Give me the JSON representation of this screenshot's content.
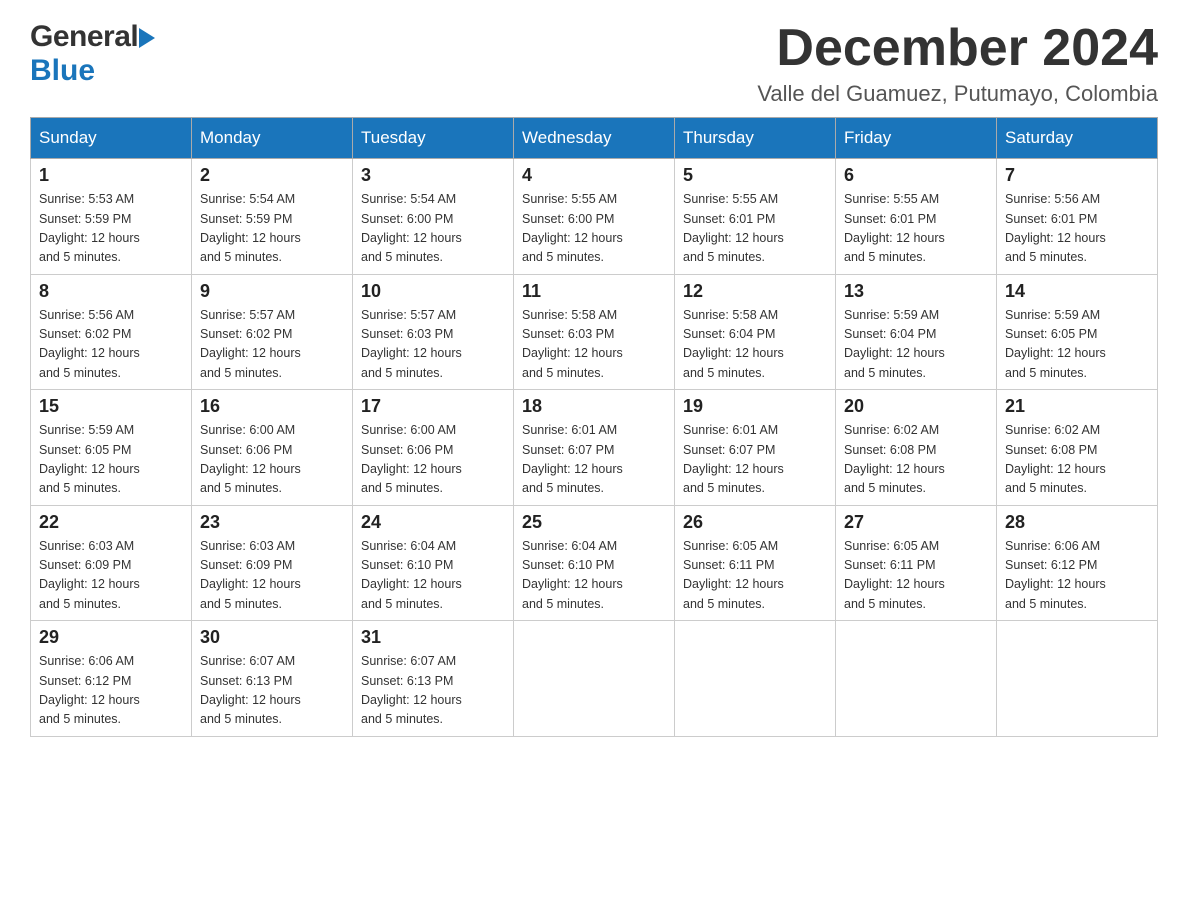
{
  "header": {
    "logo_general": "General",
    "logo_blue": "Blue",
    "month_title": "December 2024",
    "location": "Valle del Guamuez, Putumayo, Colombia"
  },
  "weekdays": [
    "Sunday",
    "Monday",
    "Tuesday",
    "Wednesday",
    "Thursday",
    "Friday",
    "Saturday"
  ],
  "weeks": [
    [
      {
        "day": "1",
        "sunrise": "5:53 AM",
        "sunset": "5:59 PM",
        "daylight": "12 hours and 5 minutes."
      },
      {
        "day": "2",
        "sunrise": "5:54 AM",
        "sunset": "5:59 PM",
        "daylight": "12 hours and 5 minutes."
      },
      {
        "day": "3",
        "sunrise": "5:54 AM",
        "sunset": "6:00 PM",
        "daylight": "12 hours and 5 minutes."
      },
      {
        "day": "4",
        "sunrise": "5:55 AM",
        "sunset": "6:00 PM",
        "daylight": "12 hours and 5 minutes."
      },
      {
        "day": "5",
        "sunrise": "5:55 AM",
        "sunset": "6:01 PM",
        "daylight": "12 hours and 5 minutes."
      },
      {
        "day": "6",
        "sunrise": "5:55 AM",
        "sunset": "6:01 PM",
        "daylight": "12 hours and 5 minutes."
      },
      {
        "day": "7",
        "sunrise": "5:56 AM",
        "sunset": "6:01 PM",
        "daylight": "12 hours and 5 minutes."
      }
    ],
    [
      {
        "day": "8",
        "sunrise": "5:56 AM",
        "sunset": "6:02 PM",
        "daylight": "12 hours and 5 minutes."
      },
      {
        "day": "9",
        "sunrise": "5:57 AM",
        "sunset": "6:02 PM",
        "daylight": "12 hours and 5 minutes."
      },
      {
        "day": "10",
        "sunrise": "5:57 AM",
        "sunset": "6:03 PM",
        "daylight": "12 hours and 5 minutes."
      },
      {
        "day": "11",
        "sunrise": "5:58 AM",
        "sunset": "6:03 PM",
        "daylight": "12 hours and 5 minutes."
      },
      {
        "day": "12",
        "sunrise": "5:58 AM",
        "sunset": "6:04 PM",
        "daylight": "12 hours and 5 minutes."
      },
      {
        "day": "13",
        "sunrise": "5:59 AM",
        "sunset": "6:04 PM",
        "daylight": "12 hours and 5 minutes."
      },
      {
        "day": "14",
        "sunrise": "5:59 AM",
        "sunset": "6:05 PM",
        "daylight": "12 hours and 5 minutes."
      }
    ],
    [
      {
        "day": "15",
        "sunrise": "5:59 AM",
        "sunset": "6:05 PM",
        "daylight": "12 hours and 5 minutes."
      },
      {
        "day": "16",
        "sunrise": "6:00 AM",
        "sunset": "6:06 PM",
        "daylight": "12 hours and 5 minutes."
      },
      {
        "day": "17",
        "sunrise": "6:00 AM",
        "sunset": "6:06 PM",
        "daylight": "12 hours and 5 minutes."
      },
      {
        "day": "18",
        "sunrise": "6:01 AM",
        "sunset": "6:07 PM",
        "daylight": "12 hours and 5 minutes."
      },
      {
        "day": "19",
        "sunrise": "6:01 AM",
        "sunset": "6:07 PM",
        "daylight": "12 hours and 5 minutes."
      },
      {
        "day": "20",
        "sunrise": "6:02 AM",
        "sunset": "6:08 PM",
        "daylight": "12 hours and 5 minutes."
      },
      {
        "day": "21",
        "sunrise": "6:02 AM",
        "sunset": "6:08 PM",
        "daylight": "12 hours and 5 minutes."
      }
    ],
    [
      {
        "day": "22",
        "sunrise": "6:03 AM",
        "sunset": "6:09 PM",
        "daylight": "12 hours and 5 minutes."
      },
      {
        "day": "23",
        "sunrise": "6:03 AM",
        "sunset": "6:09 PM",
        "daylight": "12 hours and 5 minutes."
      },
      {
        "day": "24",
        "sunrise": "6:04 AM",
        "sunset": "6:10 PM",
        "daylight": "12 hours and 5 minutes."
      },
      {
        "day": "25",
        "sunrise": "6:04 AM",
        "sunset": "6:10 PM",
        "daylight": "12 hours and 5 minutes."
      },
      {
        "day": "26",
        "sunrise": "6:05 AM",
        "sunset": "6:11 PM",
        "daylight": "12 hours and 5 minutes."
      },
      {
        "day": "27",
        "sunrise": "6:05 AM",
        "sunset": "6:11 PM",
        "daylight": "12 hours and 5 minutes."
      },
      {
        "day": "28",
        "sunrise": "6:06 AM",
        "sunset": "6:12 PM",
        "daylight": "12 hours and 5 minutes."
      }
    ],
    [
      {
        "day": "29",
        "sunrise": "6:06 AM",
        "sunset": "6:12 PM",
        "daylight": "12 hours and 5 minutes."
      },
      {
        "day": "30",
        "sunrise": "6:07 AM",
        "sunset": "6:13 PM",
        "daylight": "12 hours and 5 minutes."
      },
      {
        "day": "31",
        "sunrise": "6:07 AM",
        "sunset": "6:13 PM",
        "daylight": "12 hours and 5 minutes."
      },
      null,
      null,
      null,
      null
    ]
  ],
  "labels": {
    "sunrise": "Sunrise:",
    "sunset": "Sunset:",
    "daylight": "Daylight:"
  }
}
